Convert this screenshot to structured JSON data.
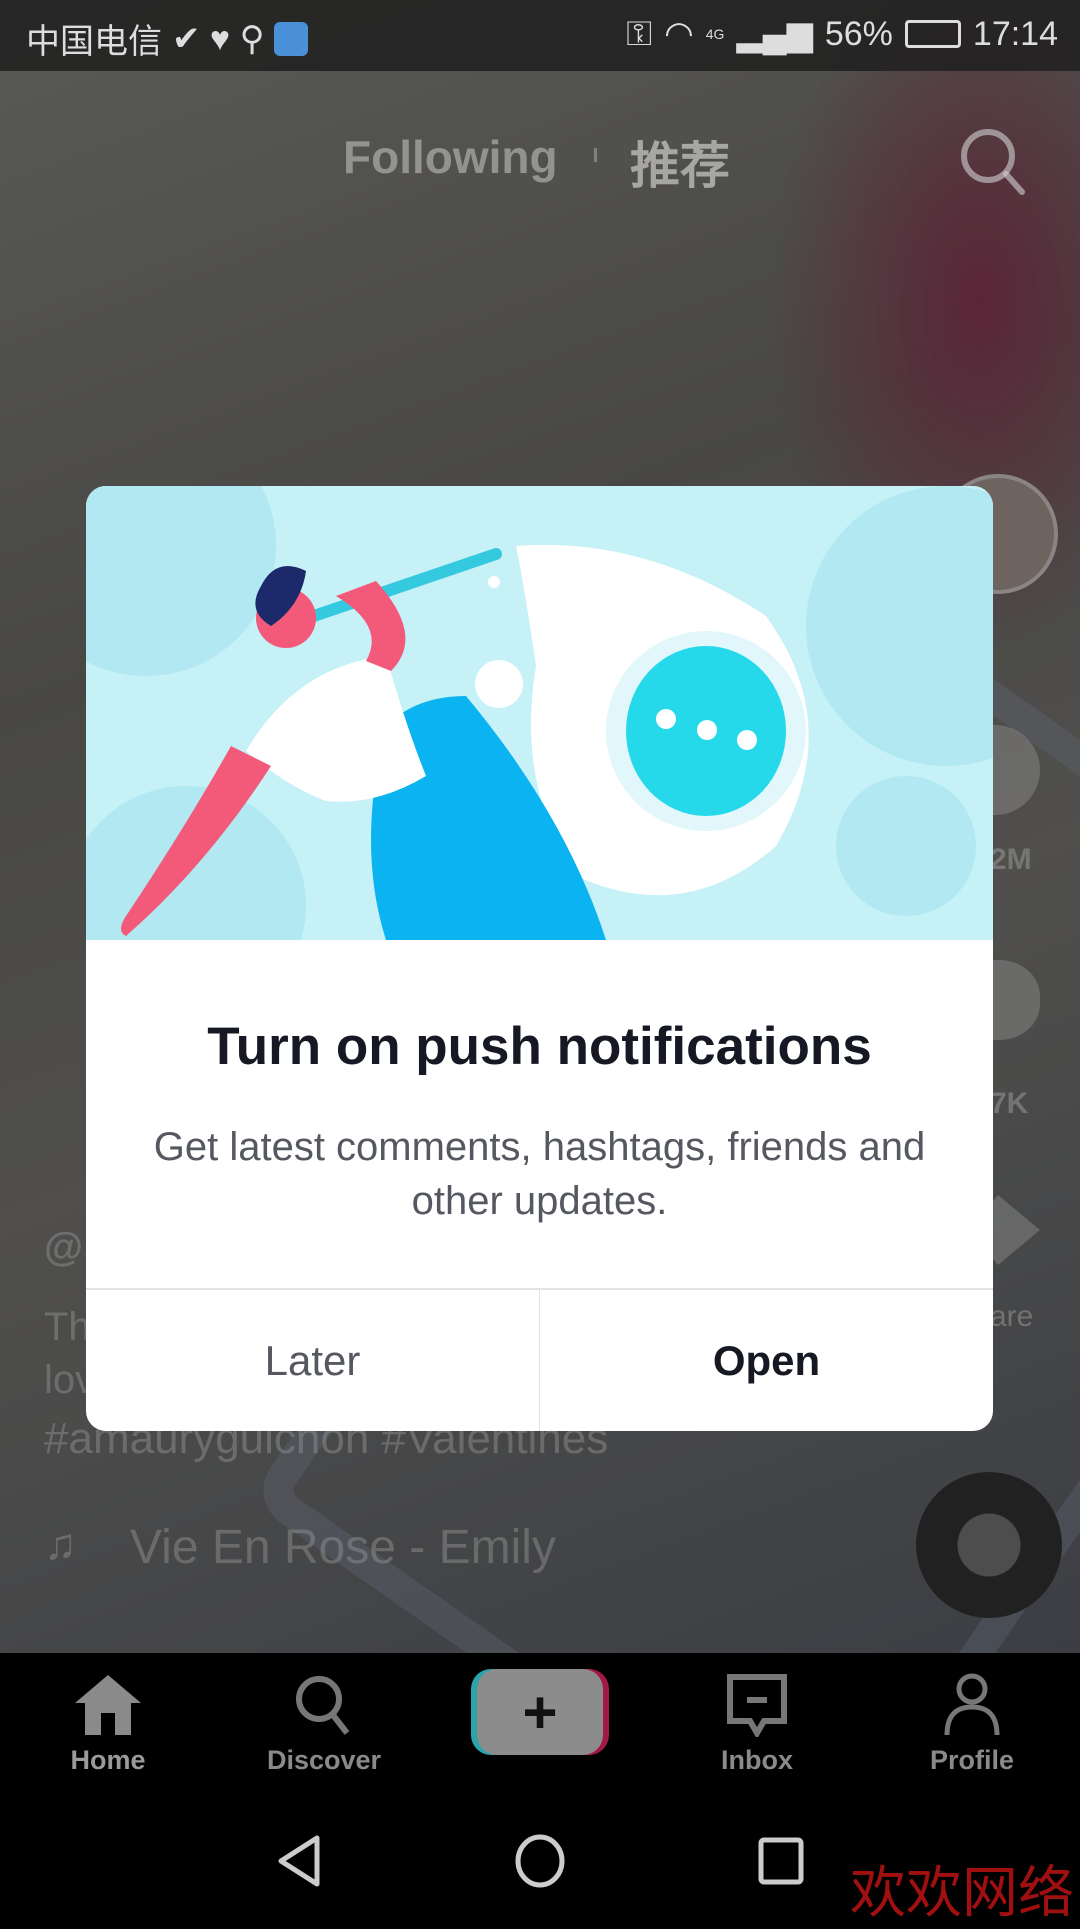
{
  "status_bar": {
    "carrier": "中国电信",
    "battery": "56%",
    "time": "17:14",
    "network": "4G"
  },
  "top_tabs": {
    "following": "Following",
    "for_you": "推荐"
  },
  "feed": {
    "username_partial": "@",
    "caption_line1_partial": "Th",
    "caption_line2_partial": "lov",
    "hashtags": "#amauryguichon #Valentines",
    "music": "Vie En Rose - Emily",
    "likes_partial": "2M",
    "comments_partial": "7K",
    "share_partial": "are"
  },
  "dialog": {
    "title": "Turn on push notifications",
    "body": "Get latest comments, hashtags, friends and other updates.",
    "later": "Later",
    "open": "Open"
  },
  "bottom_nav": {
    "items": [
      {
        "label": "Home",
        "icon": "home-icon",
        "active": true
      },
      {
        "label": "Discover",
        "icon": "search-icon"
      },
      {
        "label": "",
        "icon": "plus-icon"
      },
      {
        "label": "Inbox",
        "icon": "inbox-icon"
      },
      {
        "label": "Profile",
        "icon": "profile-icon"
      }
    ]
  },
  "watermark": "欢欢网络",
  "colors": {
    "accent_cyan": "#25d9eb",
    "accent_red": "#fe2c55",
    "dialog_text": "#161823"
  }
}
